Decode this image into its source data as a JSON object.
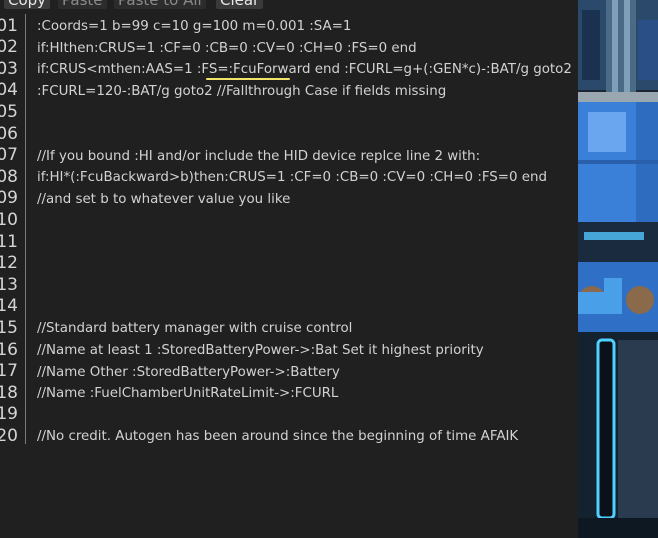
{
  "toolbar": {
    "copy": "Copy",
    "paste": "Paste",
    "paste_to_all": "Paste to All",
    "clear": "Clear"
  },
  "editor": {
    "lines": [
      {
        "num": "01",
        "text": ":Coords=1 b=99 c=10 g=100 m=0.001 :SA=1"
      },
      {
        "num": "02",
        "text": "if:HIthen:CRUS=1 :CF=0 :CB=0 :CV=0 :CH=0 :FS=0 end"
      },
      {
        "num": "03",
        "text": "if:CRUS<mthen:AAS=1 :FS=:FcuForward end :FCURL=g+(:GEN*c)-:BAT/g goto2"
      },
      {
        "num": "04",
        "text": ":FCURL=120-:BAT/g goto2 //Fallthrough Case if fields missing"
      },
      {
        "num": "05",
        "text": ""
      },
      {
        "num": "06",
        "text": ""
      },
      {
        "num": "07",
        "text": "//If you bound :HI and/or include the HID device replce line 2 with:"
      },
      {
        "num": "08",
        "text": "if:HI*(:FcuBackward>b)then:CRUS=1 :CF=0 :CB=0 :CV=0 :CH=0 :FS=0 end"
      },
      {
        "num": "09",
        "text": "//and set b to whatever value you like"
      },
      {
        "num": "10",
        "text": ""
      },
      {
        "num": "11",
        "text": ""
      },
      {
        "num": "12",
        "text": ""
      },
      {
        "num": "13",
        "text": ""
      },
      {
        "num": "14",
        "text": ""
      },
      {
        "num": "15",
        "text": "//Standard battery manager with cruise control"
      },
      {
        "num": "16",
        "text": "//Name at least 1 :StoredBatteryPower->:Bat Set it highest priority"
      },
      {
        "num": "17",
        "text": "//Name Other :StoredBatteryPower->:Battery"
      },
      {
        "num": "18",
        "text": "//Name :FuelChamberUnitRateLimit->:FCURL"
      },
      {
        "num": "19",
        "text": ""
      },
      {
        "num": "20",
        "text": "//No credit. Autogen has been around since the beginning of time AFAIK"
      }
    ]
  },
  "colors": {
    "editor_bg": "#202020",
    "code_text": "#d2d2d2",
    "highlight": "#f2e36a",
    "game_blue": "#3a7fd8"
  }
}
